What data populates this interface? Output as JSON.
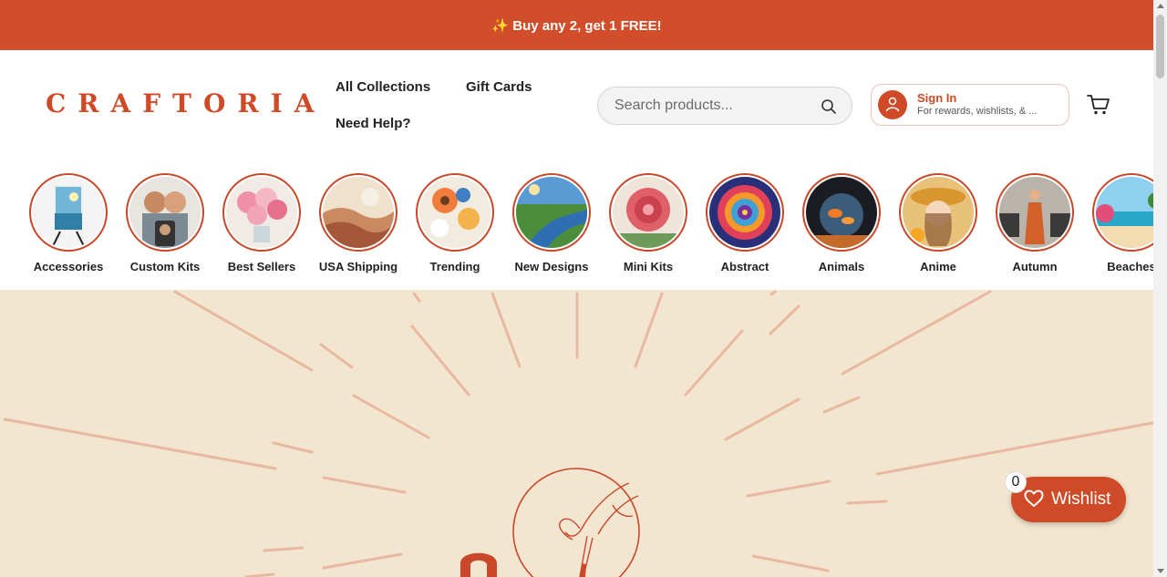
{
  "promo_banner": {
    "text": "✨ Buy any 2, get 1 FREE!"
  },
  "header": {
    "logo": "CRAFTORIA",
    "nav": [
      "All Collections",
      "Gift Cards",
      "Need Help?"
    ],
    "search": {
      "placeholder": "Search products...",
      "value": ""
    },
    "sign_in": {
      "title": "Sign In",
      "subtitle": "For rewards, wishlists, & ..."
    }
  },
  "categories": [
    {
      "label": "Accessories",
      "icon": "easel-painting"
    },
    {
      "label": "Custom Kits",
      "icon": "couple-photo"
    },
    {
      "label": "Best Sellers",
      "icon": "rose-bouquet"
    },
    {
      "label": "USA Shipping",
      "icon": "abstract-landscape"
    },
    {
      "label": "Trending",
      "icon": "orange-flowers"
    },
    {
      "label": "New Designs",
      "icon": "river-landscape"
    },
    {
      "label": "Mini Kits",
      "icon": "red-peony"
    },
    {
      "label": "Abstract",
      "icon": "mandala"
    },
    {
      "label": "Animals",
      "icon": "fishbowl"
    },
    {
      "label": "Anime",
      "icon": "anime-girl"
    },
    {
      "label": "Autumn",
      "icon": "autumn-woman"
    },
    {
      "label": "Beaches",
      "icon": "tropical-beach"
    }
  ],
  "wishlist": {
    "label": "Wishlist",
    "count": "0"
  },
  "colors": {
    "brand": "#cf4a26",
    "hero_bg": "#f2e6d0",
    "ray": "#e8b9a0"
  }
}
